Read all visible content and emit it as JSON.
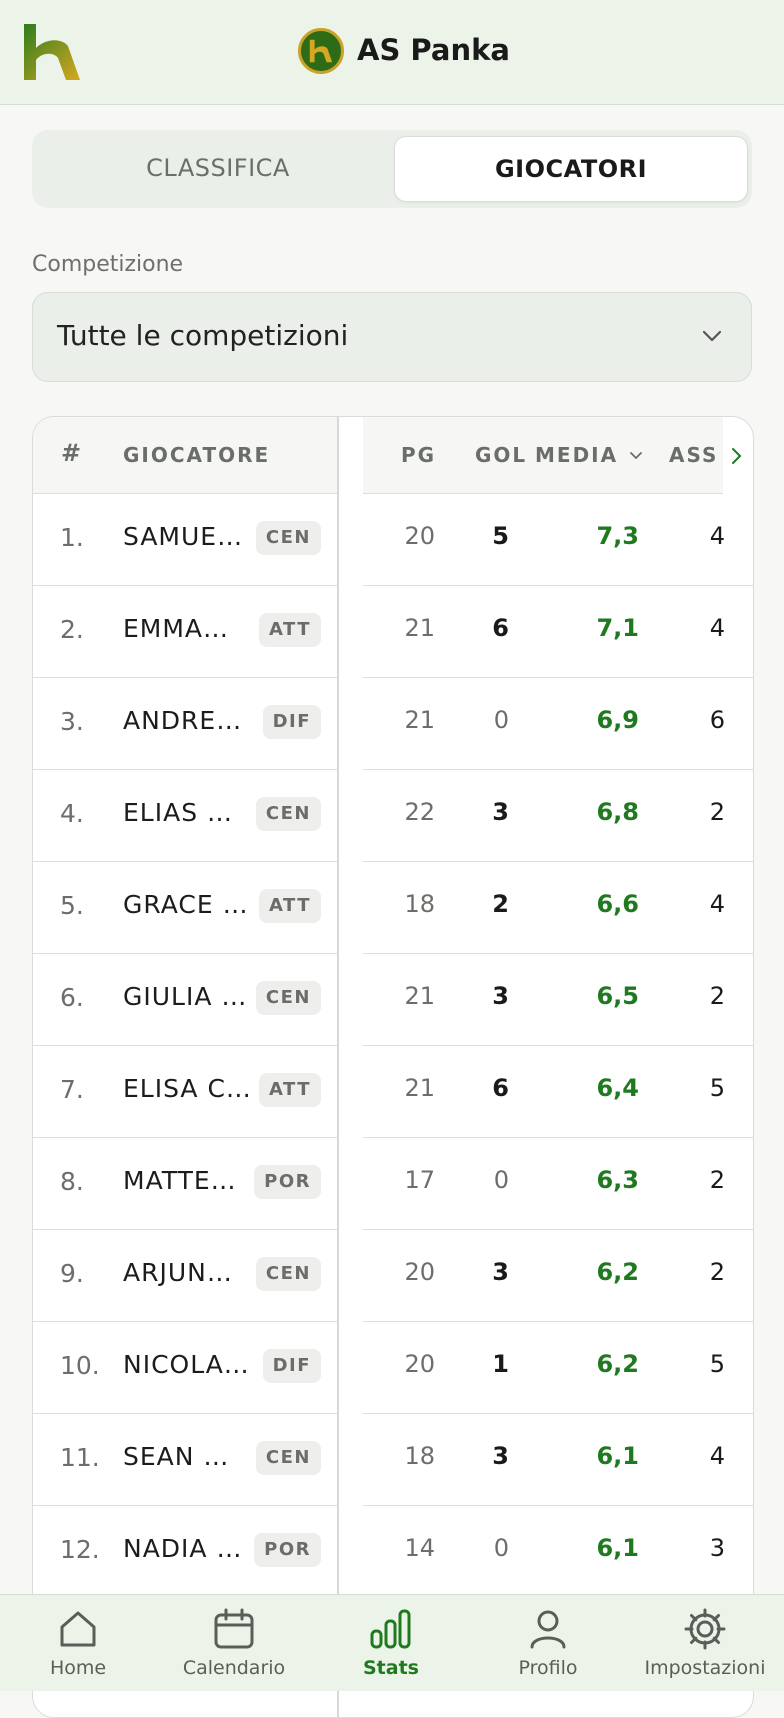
{
  "header": {
    "club_name": "AS Panka",
    "logo_icon": "app-logo-icon",
    "badge_icon": "club-badge-icon"
  },
  "tabs": [
    {
      "label": "CLASSIFICA",
      "active": false
    },
    {
      "label": "GIOCATORI",
      "active": true
    }
  ],
  "competition": {
    "label": "Competizione",
    "value": "Tutte le competizioni",
    "icon": "chevron-down-icon"
  },
  "table": {
    "headers": {
      "rank": "#",
      "player": "GIOCATORE",
      "pg": "PG",
      "gol": "GOL",
      "media": "MEDIA",
      "ass": "ASS"
    },
    "rows": [
      {
        "rank": "1.",
        "name": "SAMUE…",
        "pos": "CEN",
        "pg": "20",
        "gol": "5",
        "media": "7,3",
        "ass": "4"
      },
      {
        "rank": "2.",
        "name": "EMMA…",
        "pos": "ATT",
        "pg": "21",
        "gol": "6",
        "media": "7,1",
        "ass": "4"
      },
      {
        "rank": "3.",
        "name": "ANDRE…",
        "pos": "DIF",
        "pg": "21",
        "gol": "0",
        "media": "6,9",
        "ass": "6"
      },
      {
        "rank": "4.",
        "name": "ELIAS …",
        "pos": "CEN",
        "pg": "22",
        "gol": "3",
        "media": "6,8",
        "ass": "2"
      },
      {
        "rank": "5.",
        "name": "GRACE …",
        "pos": "ATT",
        "pg": "18",
        "gol": "2",
        "media": "6,6",
        "ass": "4"
      },
      {
        "rank": "6.",
        "name": "GIULIA …",
        "pos": "CEN",
        "pg": "21",
        "gol": "3",
        "media": "6,5",
        "ass": "2"
      },
      {
        "rank": "7.",
        "name": "ELISA C…",
        "pos": "ATT",
        "pg": "21",
        "gol": "6",
        "media": "6,4",
        "ass": "5"
      },
      {
        "rank": "8.",
        "name": "MATTE…",
        "pos": "POR",
        "pg": "17",
        "gol": "0",
        "media": "6,3",
        "ass": "2"
      },
      {
        "rank": "9.",
        "name": "ARJUN…",
        "pos": "CEN",
        "pg": "20",
        "gol": "3",
        "media": "6,2",
        "ass": "2"
      },
      {
        "rank": "10.",
        "name": "NICOLA…",
        "pos": "DIF",
        "pg": "20",
        "gol": "1",
        "media": "6,2",
        "ass": "5"
      },
      {
        "rank": "11.",
        "name": "SEAN …",
        "pos": "CEN",
        "pg": "18",
        "gol": "3",
        "media": "6,1",
        "ass": "4"
      },
      {
        "rank": "12.",
        "name": "NADIA …",
        "pos": "POR",
        "pg": "14",
        "gol": "0",
        "media": "6,1",
        "ass": "3"
      }
    ]
  },
  "nav": [
    {
      "label": "Home",
      "icon": "home-icon",
      "active": false
    },
    {
      "label": "Calendario",
      "icon": "calendar-icon",
      "active": false
    },
    {
      "label": "Stats",
      "icon": "stats-icon",
      "active": true
    },
    {
      "label": "Profilo",
      "icon": "profile-icon",
      "active": false
    },
    {
      "label": "Impostazioni",
      "icon": "settings-icon",
      "active": false
    }
  ],
  "colors": {
    "accent": "#1f7a1f",
    "header_bg": "#ecf4ea",
    "gold": "#c9a227"
  }
}
